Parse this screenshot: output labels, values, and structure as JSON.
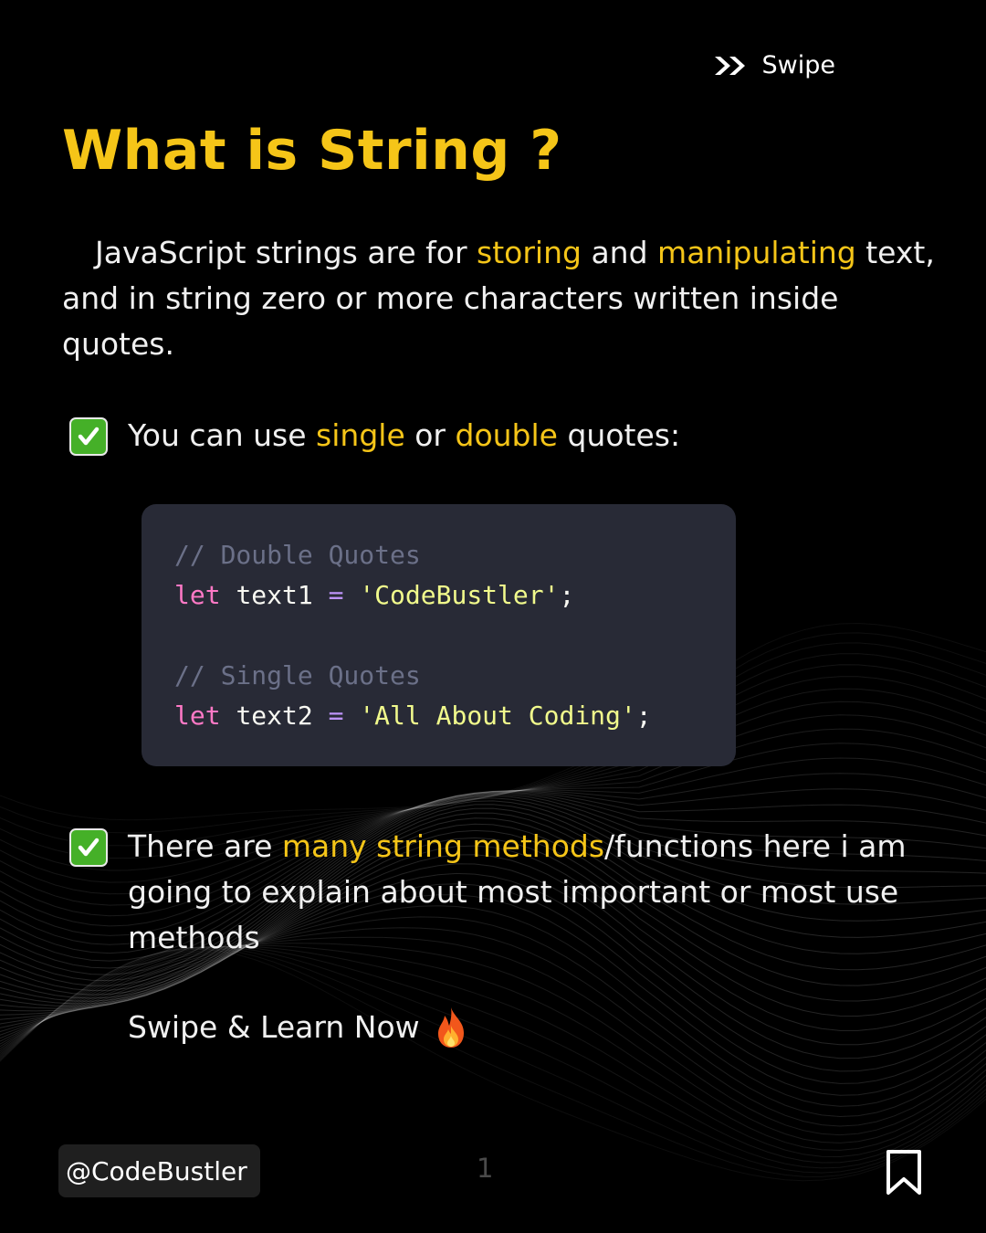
{
  "header": {
    "swipe_label": "Swipe"
  },
  "title": "What is String ?",
  "intro": {
    "part1": "JavaScript strings are for ",
    "hl1": "storing",
    "part2": " and ",
    "hl2": "manipulating",
    "part3": " text, and in string zero or more characters written inside quotes."
  },
  "points": [
    {
      "part1": "You can use ",
      "hl1": "single",
      "part2": " or ",
      "hl2": "double",
      "part3": " quotes:"
    },
    {
      "part1": "There are ",
      "hl1": "many string methods",
      "part2": "/functions here i am going to explain about most important or most use methods"
    }
  ],
  "code": {
    "comment1": "// Double Quotes",
    "line1": {
      "keyword": "let",
      "name": "text1",
      "op": "=",
      "value": "'CodeBustler'",
      "end": ";"
    },
    "comment2": "// Single Quotes",
    "line2": {
      "keyword": "let",
      "name": "text2",
      "op": "=",
      "value": "'All About Coding'",
      "end": ";"
    }
  },
  "cta": "Swipe & Learn Now",
  "footer": {
    "handle": "@CodeBustler",
    "page_number": "1"
  },
  "icons": {
    "swipe": "double-chevron-right-icon",
    "check": "check-mark-icon",
    "fire": "fire-icon",
    "bookmark": "bookmark-icon"
  },
  "colors": {
    "background": "#000000",
    "accent": "#f5c518",
    "text": "#f0f0f0",
    "code_bg": "#282a36",
    "check_green": "#45b028"
  }
}
